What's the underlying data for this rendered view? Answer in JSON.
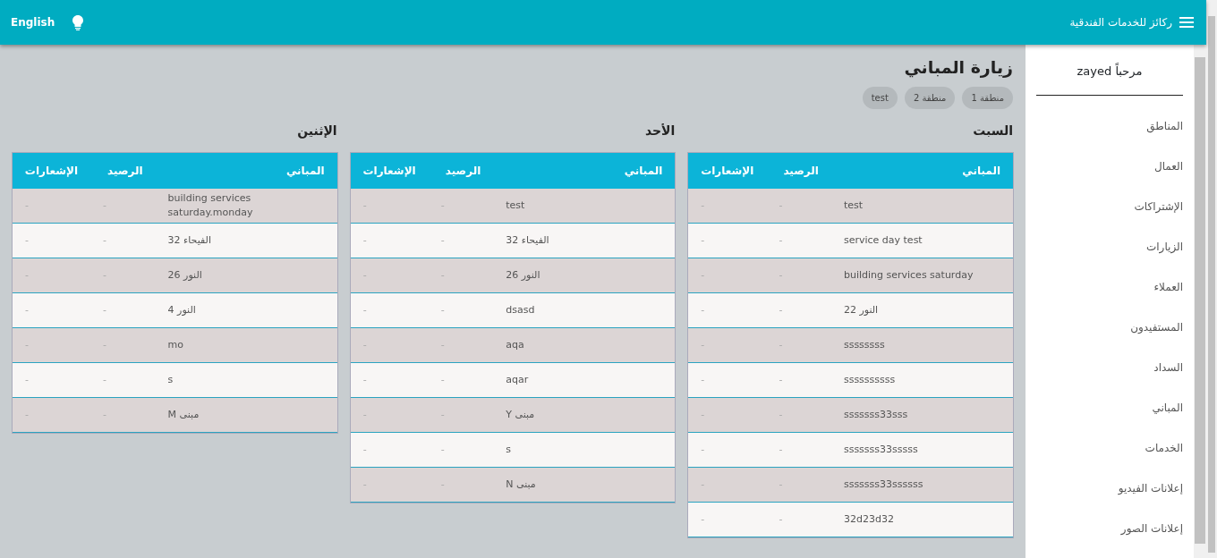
{
  "navbar": {
    "brand": "ركائز للخدمات الفندقية",
    "language": "English"
  },
  "sidebar": {
    "welcome": "مرحباً zayed",
    "items": [
      "المناطق",
      "العمال",
      "الإشتراكات",
      "الزيارات",
      "العملاء",
      "المستفيدون",
      "السداد",
      "المباني",
      "الخدمات",
      "إعلانات الفيديو",
      "إعلانات الصور"
    ]
  },
  "page": {
    "title": "زيارة المباني",
    "chips": [
      "منطقة 1",
      "منطقة 2",
      "test"
    ]
  },
  "days": [
    {
      "title": "السبت",
      "columns": [
        "المباني",
        "الرصيد",
        "الإشعارات"
      ],
      "rows": [
        [
          "test",
          "-",
          "-"
        ],
        [
          "service day test",
          "-",
          "-"
        ],
        [
          "building services saturday",
          "-",
          "-"
        ],
        [
          "النور 22",
          "-",
          "-"
        ],
        [
          "ssssssss",
          "-",
          "-"
        ],
        [
          "ssssssssss",
          "-",
          "-"
        ],
        [
          "sssssss33sss",
          "-",
          "-"
        ],
        [
          "sssssss33sssss",
          "-",
          "-"
        ],
        [
          "sssssss33ssssss",
          "-",
          "-"
        ],
        [
          "32d23d32",
          "-",
          "-"
        ]
      ]
    },
    {
      "title": "الأحد",
      "columns": [
        "المباني",
        "الرصيد",
        "الإشعارات"
      ],
      "rows": [
        [
          "test",
          "-",
          "-"
        ],
        [
          "الفيحاء 32",
          "-",
          "-"
        ],
        [
          "النور 26",
          "-",
          "-"
        ],
        [
          "dsasd",
          "-",
          "-"
        ],
        [
          "aqa",
          "-",
          "-"
        ],
        [
          "aqar",
          "-",
          "-"
        ],
        [
          "مبنى Y",
          "-",
          "-"
        ],
        [
          "s",
          "-",
          "-"
        ],
        [
          "مبنى N",
          "-",
          "-"
        ]
      ]
    },
    {
      "title": "الإثنين",
      "columns": [
        "المباني",
        "الرصيد",
        "الإشعارات"
      ],
      "rows": [
        [
          "building services saturday.monday",
          "-",
          "-"
        ],
        [
          "الفيحاء 32",
          "-",
          "-"
        ],
        [
          "النور 26",
          "-",
          "-"
        ],
        [
          "النور 4",
          "-",
          "-"
        ],
        [
          "mo",
          "-",
          "-"
        ],
        [
          "s",
          "-",
          "-"
        ],
        [
          "مبنى M",
          "-",
          "-"
        ]
      ]
    }
  ]
}
